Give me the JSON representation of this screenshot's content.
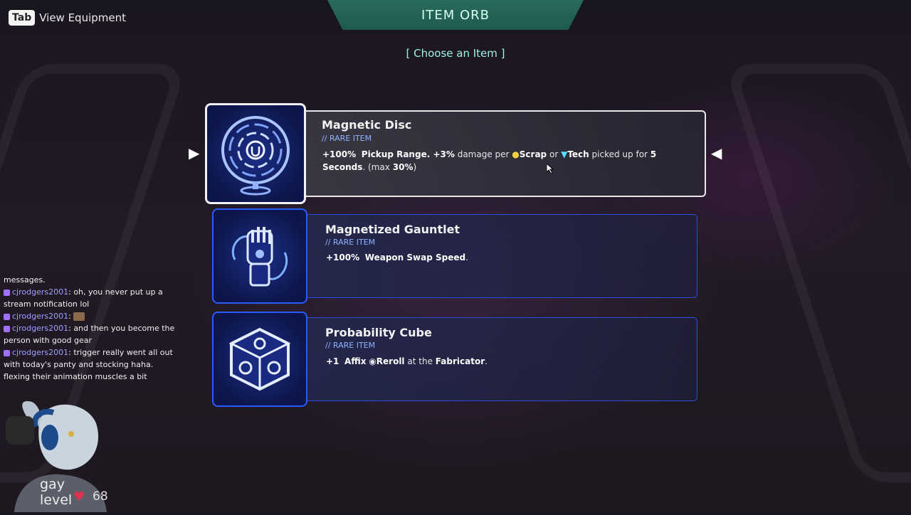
{
  "hud": {
    "tab_key": "Tab",
    "tab_label": "View Equipment",
    "title": "ITEM ORB",
    "subtitle": "[ Choose an Item ]"
  },
  "items": [
    {
      "name": "Magnetic Disc",
      "rarity": "// RARE ITEM",
      "icon": "magnetic-disc-icon",
      "selected": true,
      "desc_parts": [
        "+100%",
        "Pickup Range",
        ". +3%",
        "damage per",
        "Scrap",
        "or",
        "Tech",
        "picked up for",
        "5",
        "Seconds",
        ". (max",
        "30%",
        ")"
      ]
    },
    {
      "name": "Magnetized Gauntlet",
      "rarity": "// RARE ITEM",
      "icon": "gauntlet-icon",
      "selected": false,
      "desc_parts": [
        "+100%",
        "Weapon Swap Speed",
        "."
      ]
    },
    {
      "name": "Probability Cube",
      "rarity": "// RARE ITEM",
      "icon": "cube-icon",
      "selected": false,
      "desc_parts": [
        "+1",
        "Affix",
        "Reroll",
        "at the",
        "Fabricator",
        "."
      ]
    }
  ],
  "chat": {
    "lines": [
      {
        "text": "messages."
      },
      {
        "user": "cjrodgers2001",
        "msg": "oh, you never put up a stream notification lol"
      },
      {
        "user": "cjrodgers2001",
        "msg": ""
      },
      {
        "user": "cjrodgers2001",
        "msg": "and then you become the person with good gear"
      },
      {
        "user": "cjrodgers2001",
        "msg": "trigger really went all out with today's panty and stocking haha. flexing their animation muscles a bit"
      }
    ]
  },
  "overlay": {
    "label_line1": "gay",
    "label_line2": "level",
    "level_value": "68"
  },
  "colors": {
    "accent_teal": "#2a6b5e",
    "rare_blue": "#8fb2ff",
    "panel_border_selected": "#e8e8e8",
    "panel_border": "#2a4fd6"
  }
}
